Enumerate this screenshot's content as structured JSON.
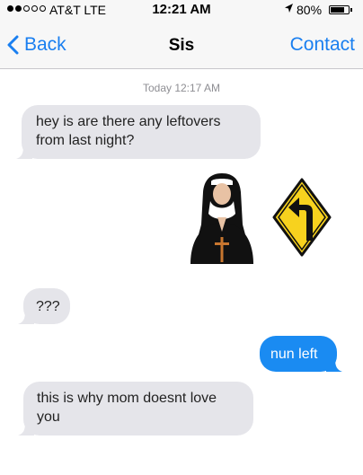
{
  "status_bar": {
    "carrier": "AT&T LTE",
    "time": "12:21 AM",
    "battery": "80%",
    "battery_level": 0.8
  },
  "nav": {
    "back_label": "Back",
    "title": "Sis",
    "contact_label": "Contact"
  },
  "conversation": {
    "timestamp": "Today 12:17 AM",
    "messages": [
      {
        "direction": "incoming",
        "text": "hey is are there any leftovers from last night?"
      },
      {
        "direction": "outgoing",
        "emoji": [
          "nun-emoji",
          "left-turn-sign-emoji"
        ]
      },
      {
        "direction": "incoming",
        "text": "???"
      },
      {
        "direction": "outgoing",
        "text": "nun left"
      },
      {
        "direction": "incoming",
        "text": "this is why mom doesnt love you"
      }
    ]
  },
  "colors": {
    "accent": "#1a7ff0",
    "outgoing_bubble": "#1a8bf2",
    "incoming_bubble": "#e5e5ea",
    "sign_yellow": "#f7d21e"
  }
}
